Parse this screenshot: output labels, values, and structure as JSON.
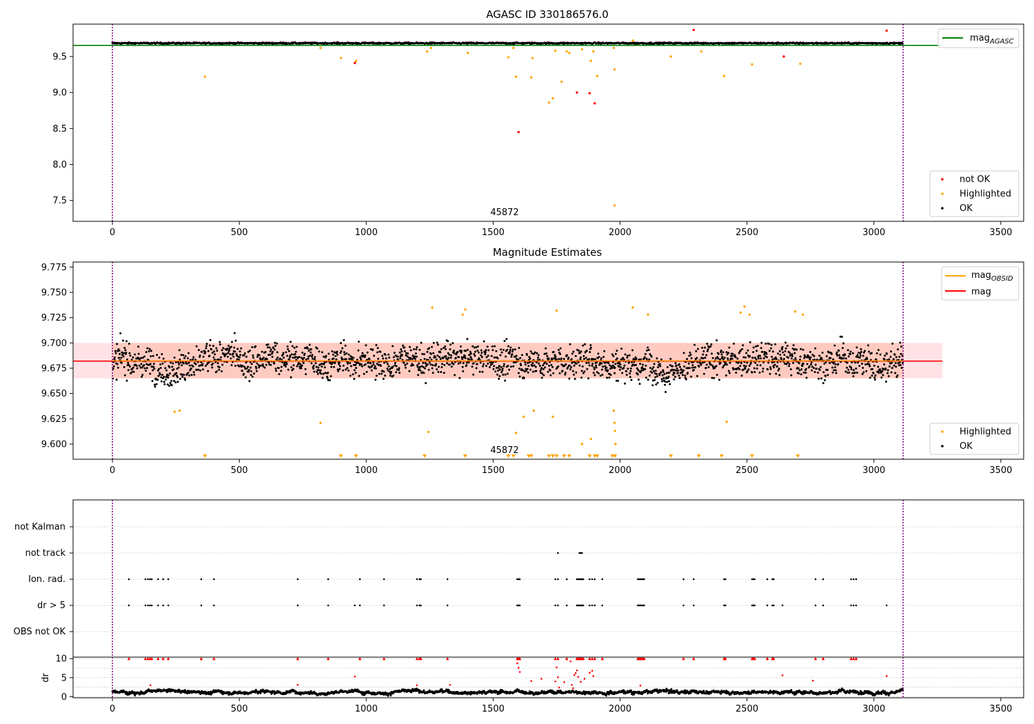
{
  "figure": {
    "suptitle": "AGASC ID 330186576.0"
  },
  "chart_data": [
    {
      "type": "scatter",
      "title": "AGASC ID 330186576.0",
      "xlabel": "",
      "ylabel": "",
      "xlim": [
        -155,
        3590
      ],
      "ylim": [
        7.21,
        9.95
      ],
      "xticks": [
        "0",
        "500",
        "1000",
        "1500",
        "2000",
        "2500",
        "3000",
        "3500"
      ],
      "yticks": [
        "7.5",
        "8.0",
        "8.5",
        "9.0",
        "9.5"
      ],
      "annotation": "45872",
      "obsid_bounds": [
        0,
        3115
      ],
      "mag_agasc": 9.655,
      "legend_upper": [
        "mag_AGASC"
      ],
      "legend_lower": [
        "not OK",
        "Highlighted",
        "OK"
      ],
      "ok_band": {
        "center": 9.685,
        "halfwidth": 0.015
      },
      "not_ok": [
        [
          955,
          9.41
        ],
        [
          1600,
          8.45
        ],
        [
          1830,
          9.0
        ],
        [
          1880,
          8.99
        ],
        [
          1900,
          8.85
        ],
        [
          2290,
          9.87
        ],
        [
          2645,
          9.5
        ],
        [
          3050,
          9.86
        ]
      ],
      "highlighted": [
        [
          365,
          9.22
        ],
        [
          820,
          9.62
        ],
        [
          900,
          9.48
        ],
        [
          960,
          9.44
        ],
        [
          1240,
          9.57
        ],
        [
          1255,
          9.62
        ],
        [
          1400,
          9.55
        ],
        [
          1560,
          9.49
        ],
        [
          1580,
          9.62
        ],
        [
          1590,
          9.22
        ],
        [
          1650,
          9.21
        ],
        [
          1655,
          9.48
        ],
        [
          1720,
          8.86
        ],
        [
          1735,
          8.92
        ],
        [
          1745,
          9.58
        ],
        [
          1770,
          9.15
        ],
        [
          1790,
          9.57
        ],
        [
          1800,
          9.55
        ],
        [
          1850,
          9.6
        ],
        [
          1885,
          9.44
        ],
        [
          1895,
          9.57
        ],
        [
          1910,
          9.23
        ],
        [
          1975,
          9.62
        ],
        [
          1978,
          9.32
        ],
        [
          1978,
          7.43
        ],
        [
          2050,
          9.72
        ],
        [
          2200,
          9.5
        ],
        [
          2320,
          9.57
        ],
        [
          2410,
          9.23
        ],
        [
          2520,
          9.39
        ],
        [
          2710,
          9.4
        ]
      ],
      "highlighted_legend": "Highlighted"
    },
    {
      "type": "scatter",
      "title": "Magnitude Estimates",
      "xlabel": "",
      "ylabel": "",
      "xlim": [
        -155,
        3590
      ],
      "ylim": [
        9.585,
        9.78
      ],
      "xticks": [
        "0",
        "500",
        "1000",
        "1500",
        "2000",
        "2500",
        "3000",
        "3500"
      ],
      "yticks": [
        "9.600",
        "9.625",
        "9.650",
        "9.675",
        "9.700",
        "9.725",
        "9.750",
        "9.775"
      ],
      "annotation": "45872",
      "mag": 9.682,
      "mag_band": [
        9.665,
        9.7
      ],
      "legend_upper": [
        "mag_OBSID",
        "mag"
      ],
      "legend_lower": [
        "Highlighted",
        "OK"
      ],
      "highlighted": [
        [
          245,
          9.632
        ],
        [
          265,
          9.633
        ],
        [
          820,
          9.621
        ],
        [
          1245,
          9.612
        ],
        [
          1260,
          9.735
        ],
        [
          1380,
          9.728
        ],
        [
          1390,
          9.733
        ],
        [
          1590,
          9.611
        ],
        [
          1620,
          9.627
        ],
        [
          1660,
          9.633
        ],
        [
          1735,
          9.627
        ],
        [
          1750,
          9.732
        ],
        [
          1850,
          9.6
        ],
        [
          1885,
          9.605
        ],
        [
          1975,
          9.633
        ],
        [
          1978,
          9.621
        ],
        [
          1980,
          9.613
        ],
        [
          1982,
          9.6
        ],
        [
          2050,
          9.735
        ],
        [
          2110,
          9.728
        ],
        [
          2420,
          9.622
        ],
        [
          2475,
          9.73
        ],
        [
          2490,
          9.736
        ],
        [
          2510,
          9.728
        ],
        [
          2690,
          9.731
        ],
        [
          2720,
          9.728
        ]
      ],
      "below_markers_x": [
        365,
        900,
        960,
        1230,
        1390,
        1560,
        1580,
        1640,
        1650,
        1720,
        1735,
        1750,
        1780,
        1800,
        1880,
        1900,
        1910,
        1970,
        1980,
        2200,
        2310,
        2400,
        2520,
        2700
      ]
    },
    {
      "type": "scatter",
      "title": "",
      "xlabel": "",
      "ylabel": "",
      "xlim": [
        -155,
        3590
      ],
      "yticks_labels": [
        "not Kalman",
        "not track",
        "Ion. rad.",
        "dr > 5",
        "OBS not OK"
      ],
      "not_track": [
        1755,
        1840,
        1845,
        1850
      ],
      "ion_rad": [
        65,
        130,
        140,
        148,
        155,
        180,
        200,
        220,
        350,
        400,
        730,
        850,
        975,
        1070,
        1200,
        1210,
        1215,
        1320,
        1595,
        1600,
        1605,
        1745,
        1755,
        1790,
        1830,
        1835,
        1840,
        1845,
        1850,
        1855,
        1880,
        1890,
        1900,
        1930,
        2070,
        2075,
        2080,
        2085,
        2090,
        2095,
        2250,
        2290,
        2410,
        2415,
        2520,
        2525,
        2530,
        2580,
        2600,
        2605,
        2770,
        2800,
        2910,
        2920,
        2930
      ],
      "dr5": [
        65,
        130,
        140,
        148,
        155,
        180,
        200,
        220,
        350,
        400,
        730,
        850,
        955,
        975,
        1070,
        1200,
        1210,
        1215,
        1320,
        1595,
        1600,
        1605,
        1745,
        1755,
        1790,
        1830,
        1835,
        1840,
        1845,
        1850,
        1855,
        1880,
        1890,
        1900,
        1930,
        2070,
        2075,
        2080,
        2085,
        2090,
        2095,
        2250,
        2290,
        2410,
        2415,
        2520,
        2525,
        2530,
        2580,
        2600,
        2605,
        2640,
        2770,
        2800,
        2910,
        2920,
        2930,
        3050
      ]
    },
    {
      "type": "scatter",
      "title": "",
      "xlabel": "",
      "ylabel": "dr",
      "xlim": [
        -155,
        3590
      ],
      "ylim": [
        -0.3,
        10.4
      ],
      "xticks": [
        "0",
        "500",
        "1000",
        "1500",
        "2000",
        "2500",
        "3000",
        "3500"
      ],
      "yticks": [
        "0",
        "5",
        "10"
      ],
      "red_points": [
        [
          65,
          10
        ],
        [
          130,
          10
        ],
        [
          140,
          10
        ],
        [
          148,
          10
        ],
        [
          155,
          10
        ],
        [
          180,
          10
        ],
        [
          200,
          10
        ],
        [
          220,
          10
        ],
        [
          350,
          10
        ],
        [
          400,
          10
        ],
        [
          730,
          10
        ],
        [
          850,
          10
        ],
        [
          975,
          10
        ],
        [
          1070,
          10
        ],
        [
          1200,
          10
        ],
        [
          1210,
          10
        ],
        [
          1215,
          10
        ],
        [
          1320,
          10
        ],
        [
          1595,
          10
        ],
        [
          1600,
          10
        ],
        [
          1605,
          10
        ],
        [
          1745,
          10
        ],
        [
          1755,
          10
        ],
        [
          1790,
          10
        ],
        [
          1830,
          10
        ],
        [
          1835,
          10
        ],
        [
          1840,
          10
        ],
        [
          1845,
          10
        ],
        [
          1850,
          10
        ],
        [
          1855,
          10
        ],
        [
          1880,
          10
        ],
        [
          1890,
          10
        ],
        [
          1900,
          10
        ],
        [
          1930,
          10
        ],
        [
          2070,
          10
        ],
        [
          2075,
          10
        ],
        [
          2080,
          10
        ],
        [
          2085,
          10
        ],
        [
          2090,
          10
        ],
        [
          2095,
          10
        ],
        [
          2250,
          10
        ],
        [
          2290,
          10
        ],
        [
          2410,
          10
        ],
        [
          2415,
          10
        ],
        [
          2520,
          10
        ],
        [
          2525,
          10
        ],
        [
          2530,
          10
        ],
        [
          2580,
          10
        ],
        [
          2600,
          10
        ],
        [
          2605,
          10
        ],
        [
          2770,
          10
        ],
        [
          2800,
          10
        ],
        [
          2910,
          10
        ],
        [
          2920,
          10
        ],
        [
          2930,
          10
        ],
        [
          955,
          5.3
        ],
        [
          1595,
          8.8
        ],
        [
          1600,
          7.6
        ],
        [
          1605,
          6.5
        ],
        [
          1650,
          4.1
        ],
        [
          1690,
          4.7
        ],
        [
          1745,
          4.0
        ],
        [
          1750,
          7.7
        ],
        [
          1755,
          5.1
        ],
        [
          1760,
          2.4
        ],
        [
          1780,
          3.8
        ],
        [
          1805,
          9.3
        ],
        [
          1810,
          3.1
        ],
        [
          1815,
          2.2
        ],
        [
          1820,
          5.7
        ],
        [
          1825,
          6.2
        ],
        [
          1830,
          6.9
        ],
        [
          1835,
          5.2
        ],
        [
          1845,
          3.9
        ],
        [
          1860,
          4.7
        ],
        [
          1880,
          6.3
        ],
        [
          1890,
          6.8
        ],
        [
          1895,
          5.4
        ],
        [
          2080,
          2.9
        ],
        [
          2640,
          5.6
        ],
        [
          2760,
          4.2
        ],
        [
          3050,
          5.4
        ],
        [
          150,
          3.0
        ],
        [
          730,
          3.1
        ],
        [
          1200,
          3.0
        ],
        [
          1330,
          3.1
        ]
      ]
    }
  ]
}
